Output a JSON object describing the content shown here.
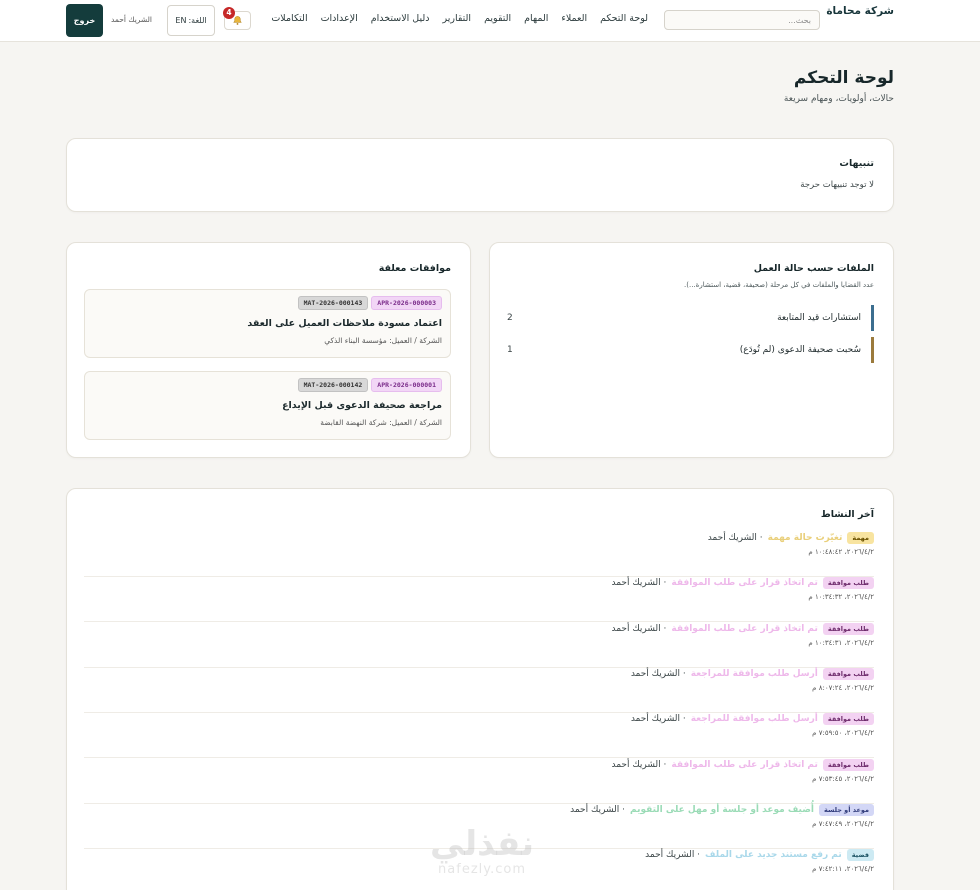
{
  "topbar": {
    "brand": "شركة محاماة",
    "search_placeholder": "بحث...",
    "nav": [
      "لوحة التحكم",
      "العملاء",
      "المهام",
      "التقويم",
      "التقارير",
      "دليل الاستخدام",
      "الإعدادات",
      "التكاملات"
    ],
    "notifications_count": "4",
    "language_label": "اللغة:",
    "language_value": "EN",
    "user_name": "الشريك أحمد",
    "logout_label": "خروج"
  },
  "header": {
    "title": "لوحة التحكم",
    "subtitle": "حالات، أولويات، ومهام سريعة"
  },
  "alerts": {
    "title": "تنبيهات",
    "empty_text": "لا توجد تنبيهات حرجة"
  },
  "files_by_status": {
    "title": "الملفات حسب حالة العمل",
    "subtitle": "عدد القضايا والملفات في كل مرحلة (صحيفة، قضية، استشارة...).",
    "rows": [
      {
        "label": "استشارات قيد المتابعة",
        "count": "2",
        "color": "#3c6e8f"
      },
      {
        "label": "سُحبت صحيفة الدعوى (لم تُودَع)",
        "count": "1",
        "color": "#9b7a3c"
      }
    ]
  },
  "approvals": {
    "title": "موافقات معلقة",
    "items": [
      {
        "apr_code": "APR-2026-000003",
        "mat_code": "MAT-2026-000143",
        "title": "اعتماد مسودة ملاحظات العميل على العقد",
        "client": "الشركة / العميل: مؤسسة البناء الذكي"
      },
      {
        "apr_code": "APR-2026-000001",
        "mat_code": "MAT-2026-000142",
        "title": "مراجعة صحيفة الدعوى قبل الإيداع",
        "client": "الشركة / العميل: شركة النهضة القابضة"
      }
    ]
  },
  "activity": {
    "title": "آخر النشاط",
    "items": [
      {
        "badge": "مهمة",
        "text": "تغيّرت حالة مهمة",
        "by": "· الشريك أحمد",
        "time": "٢٠٢٦/٤/٢، ١٠:٤٨:٤٢ م",
        "badge_bg": "#f8e4a0",
        "badge_fg": "#6b5200",
        "text_color": "#e9cf7a"
      },
      {
        "badge": "طلب موافقة",
        "text": "تم اتخاذ قرار على طلب الموافقة",
        "by": "· الشريك أحمد",
        "time": "٢٠٢٦/٤/٢، ١٠:٣٤:٣٢ م",
        "badge_bg": "#f3d2f2",
        "badge_fg": "#6d2a6b",
        "text_color": "#eeb8ea"
      },
      {
        "badge": "طلب موافقة",
        "text": "تم اتخاذ قرار على طلب الموافقة",
        "by": "· الشريك أحمد",
        "time": "٢٠٢٦/٤/٢، ١٠:٣٤:٣١ م",
        "badge_bg": "#f3d2f2",
        "badge_fg": "#6d2a6b",
        "text_color": "#eeb8ea"
      },
      {
        "badge": "طلب موافقة",
        "text": "أرسل طلب موافقة للمراجعة",
        "by": "· الشريك أحمد",
        "time": "٢٠٢٦/٤/٢، ٨:٠٧:٢٤ م",
        "badge_bg": "#f3d2f2",
        "badge_fg": "#6d2a6b",
        "text_color": "#eeb8ea"
      },
      {
        "badge": "طلب موافقة",
        "text": "أرسل طلب موافقة للمراجعة",
        "by": "· الشريك أحمد",
        "time": "٢٠٢٦/٤/٢، ٧:٥٩:٥٠ م",
        "badge_bg": "#f3d2f2",
        "badge_fg": "#6d2a6b",
        "text_color": "#eeb8ea"
      },
      {
        "badge": "طلب موافقة",
        "text": "تم اتخاذ قرار على طلب الموافقة",
        "by": "· الشريك أحمد",
        "time": "٢٠٢٦/٤/٢، ٧:٥٣:٤٥ م",
        "badge_bg": "#f3d2f2",
        "badge_fg": "#6d2a6b",
        "text_color": "#eeb8ea"
      },
      {
        "badge": "موعد أو جلسة",
        "text": "أُضيف موعد أو جلسة أو مهل على التقويم",
        "by": "· الشريك أحمد",
        "time": "٢٠٢٦/٤/٢، ٧:٤٧:٤٩ م",
        "badge_bg": "#d3d7f6",
        "badge_fg": "#2f3a7a",
        "text_color": "#9adbb6"
      },
      {
        "badge": "قضية",
        "text": "تم رفع مستند جديد على الملف",
        "by": "· الشريك أحمد",
        "time": "٢٠٢٦/٤/٢، ٧:٤٢:١١ م",
        "badge_bg": "#cdeaf3",
        "badge_fg": "#1f5566",
        "text_color": "#a9d8ea"
      }
    ]
  },
  "watermark": {
    "arabic": "نفذلي",
    "latin": "nafezly.com"
  }
}
